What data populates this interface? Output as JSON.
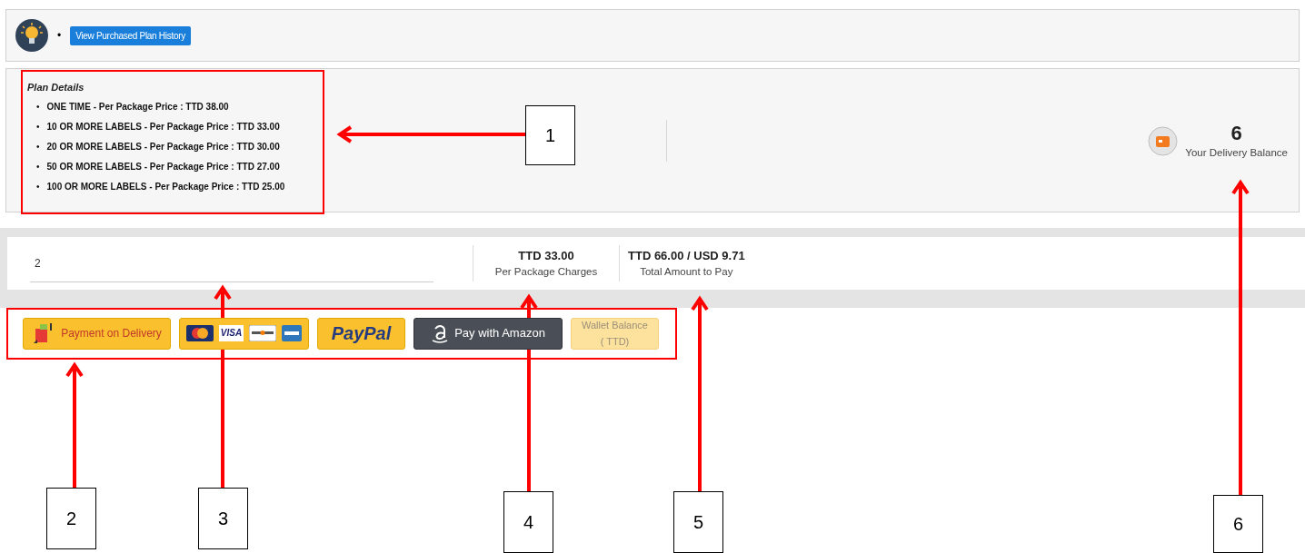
{
  "header": {
    "bullet": "•",
    "history_button": "View Purchased Plan History"
  },
  "plan": {
    "title": "Plan Details",
    "marker": "•",
    "items": [
      {
        "text": "ONE TIME - Per Package Price : TTD 38.00"
      },
      {
        "text": "10 OR MORE LABELS - Per Package Price : TTD 33.00"
      },
      {
        "text": "20 OR MORE LABELS - Per Package Price : TTD 30.00"
      },
      {
        "text": "50 OR MORE LABELS - Per Package Price : TTD 27.00"
      },
      {
        "text": "100 OR MORE LABELS - Per Package Price : TTD 25.00"
      }
    ]
  },
  "balance": {
    "value": "6",
    "label": "Your Delivery Balance"
  },
  "order": {
    "quantity": "2",
    "per_package": {
      "amount": "TTD 33.00",
      "label": "Per Package Charges"
    },
    "total": {
      "amount": "TTD 66.00 / USD 9.71",
      "label": "Total Amount to Pay"
    }
  },
  "payment_options": [
    {
      "kind": "cod",
      "label": "Payment on Delivery",
      "disabled": false
    },
    {
      "kind": "cards",
      "label": "VISA",
      "disabled": false
    },
    {
      "kind": "paypal",
      "label": "PayPal",
      "disabled": false
    },
    {
      "kind": "amazon",
      "label": "Pay with Amazon",
      "disabled": false
    },
    {
      "kind": "wallet",
      "label": "Wallet Balance",
      "sublabel": "( TTD)",
      "disabled": true
    }
  ],
  "annotations": [
    {
      "label": "1"
    },
    {
      "label": "2"
    },
    {
      "label": "3"
    },
    {
      "label": "4"
    },
    {
      "label": "5"
    },
    {
      "label": "6"
    }
  ]
}
